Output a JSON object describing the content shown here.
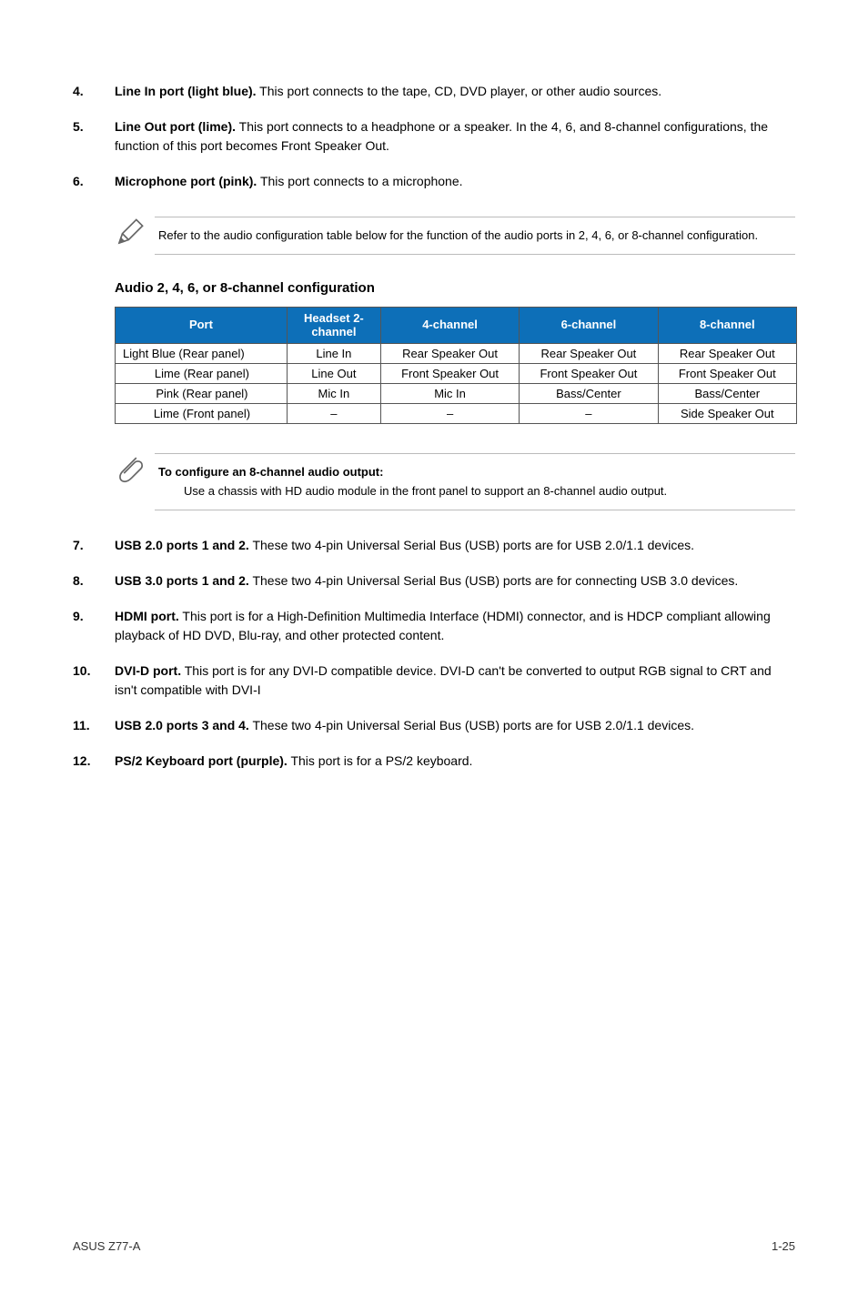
{
  "items_top": [
    {
      "num": "4.",
      "lead": "Line In port (light blue).",
      "rest": " This port connects to the tape, CD, DVD player, or other audio sources."
    },
    {
      "num": "5.",
      "lead": "Line Out port (lime).",
      "rest": " This port connects to a headphone or a speaker. In the 4, 6, and 8-channel configurations, the function of this port becomes Front Speaker Out."
    },
    {
      "num": "6.",
      "lead": "Microphone port (pink).",
      "rest": " This port connects to a microphone."
    }
  ],
  "note1": "Refer to the audio configuration table below for the function of the audio ports in 2, 4, 6, or 8-channel configuration.",
  "subhead": "Audio 2, 4, 6, or 8-channel configuration",
  "table": {
    "headers": [
      "Port",
      "Headset 2-channel",
      "4-channel",
      "6-channel",
      "8-channel"
    ],
    "rows": [
      [
        "Light Blue (Rear panel)",
        "Line In",
        "Rear Speaker Out",
        "Rear Speaker Out",
        "Rear Speaker Out"
      ],
      [
        "Lime (Rear panel)",
        "Line Out",
        "Front Speaker Out",
        "Front Speaker Out",
        "Front Speaker Out"
      ],
      [
        "Pink (Rear panel)",
        "Mic In",
        "Mic In",
        "Bass/Center",
        "Bass/Center"
      ],
      [
        "Lime (Front panel)",
        "–",
        "–",
        "–",
        "Side Speaker Out"
      ]
    ]
  },
  "note2": {
    "lead": "To configure an 8-channel audio output:",
    "sub": "Use a chassis with HD audio module in the front panel to support an 8-channel audio output."
  },
  "items_bottom": [
    {
      "num": "7.",
      "lead": "USB 2.0 ports 1 and 2.",
      "rest": " These two 4-pin Universal Serial Bus (USB) ports are for USB 2.0/1.1 devices."
    },
    {
      "num": "8.",
      "lead": "USB 3.0 ports 1 and 2.",
      "rest": " These two 4-pin Universal Serial Bus (USB) ports are for connecting USB 3.0 devices."
    },
    {
      "num": "9.",
      "lead": "HDMI port.",
      "rest": " This port is for a High-Definition Multimedia Interface (HDMI) connector, and is HDCP compliant allowing playback of HD DVD, Blu-ray, and other protected content."
    },
    {
      "num": "10.",
      "lead": "DVI-D port.",
      "rest": " This port is for any DVI-D compatible device. DVI-D can't be converted to output RGB signal to CRT and isn't compatible with DVI-I"
    },
    {
      "num": "11.",
      "lead": "USB 2.0 ports 3 and 4.",
      "rest": " These two 4-pin Universal Serial Bus (USB) ports are for USB 2.0/1.1 devices."
    },
    {
      "num": "12.",
      "lead": "PS/2 Keyboard port (purple).",
      "rest": " This port is for a PS/2 keyboard."
    }
  ],
  "footer_left": "ASUS Z77-A",
  "footer_right": "1-25"
}
